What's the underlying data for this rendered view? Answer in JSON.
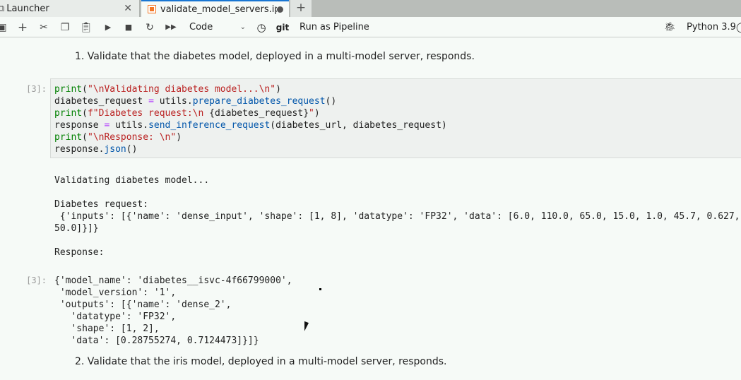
{
  "tabs": [
    {
      "label": "Launcher"
    },
    {
      "label": "validate_model_servers.ipynb"
    }
  ],
  "toolbar": {
    "cell_type": "Code",
    "git": "git",
    "run_pipeline": "Run as Pipeline",
    "kernel": "Python 3.9"
  },
  "cells": {
    "md1": "1. Validate that the diabetes model, deployed in a multi-model server, responds.",
    "prompt_in": "[3]:",
    "code_lines": [
      [
        "print",
        "(",
        "\"\\nValidating diabetes model...\\n\"",
        ")"
      ],
      [
        "diabetes_request ",
        "=",
        " utils.",
        "prepare_diabetes_request",
        "()"
      ],
      [
        "print",
        "(",
        "f\"Diabetes request:\\n ",
        "{diabetes_request}",
        "\"",
        ")"
      ],
      [
        "response ",
        "=",
        " utils.",
        "send_inference_request",
        "(diabetes_url, diabetes_request)"
      ],
      [
        "print",
        "(",
        "\"\\nResponse: \\n\"",
        ")"
      ],
      [
        "response.",
        "json",
        "()"
      ]
    ],
    "stdout": "Validating diabetes model...\n\nDiabetes request:\n {'inputs': [{'name': 'dense_input', 'shape': [1, 8], 'datatype': 'FP32', 'data': [6.0, 110.0, 65.0, 15.0, 1.0, 45.7, 0.627,\n50.0]}]}\n\nResponse:",
    "prompt_out": "[3]:",
    "result": "{'model_name': 'diabetes__isvc-4f66799000',\n 'model_version': '1',\n 'outputs': [{'name': 'dense_2',\n   'datatype': 'FP32',\n   'shape': [1, 2],\n   'data': [0.28755274, 0.7124473]}]}",
    "md2": "2. Validate that the iris model, deployed in a multi-model server, responds."
  }
}
